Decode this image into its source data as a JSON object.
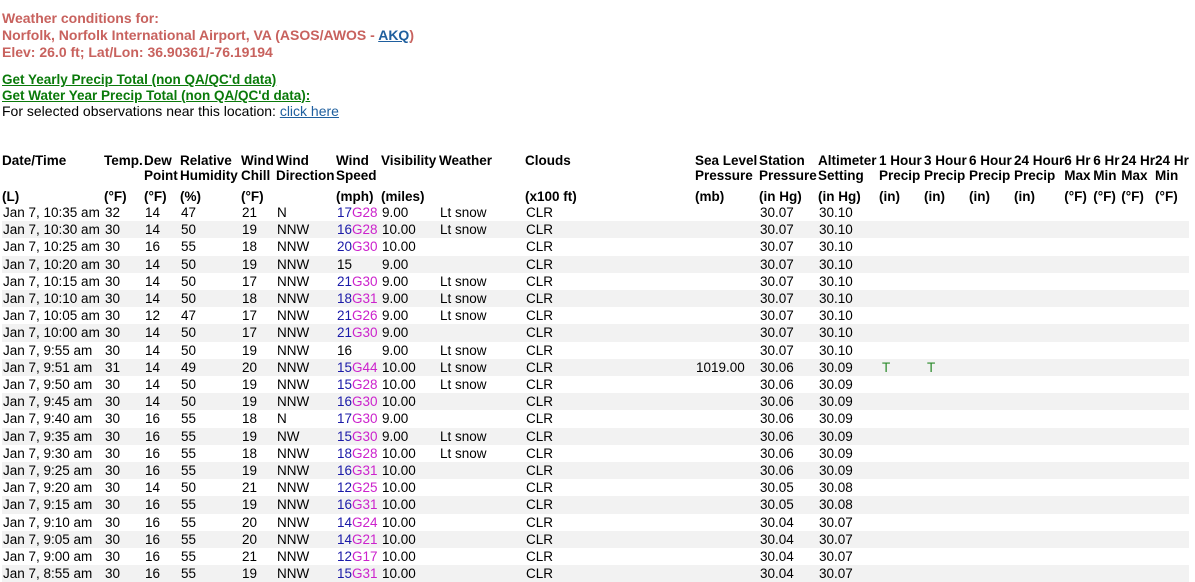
{
  "header": {
    "line1": "Weather conditions for:",
    "line2_prefix": "Norfolk, Norfolk International Airport, VA (ASOS/AWOS - ",
    "line2_link": "AKQ",
    "line2_suffix": ")",
    "line3": "Elev: 26.0 ft; Lat/Lon: 36.90361/-76.19194"
  },
  "links": {
    "yearly": "Get Yearly Precip Total (non QA/QC'd data)",
    "water_year": "Get Water Year Precip Total (non QA/QC'd data):",
    "near_text": "For selected observations near this location: ",
    "near_link": "click here"
  },
  "columns": {
    "date": [
      "Date/Time",
      "",
      "",
      "(L)"
    ],
    "temp": [
      "Temp.",
      "",
      "",
      "(°F)"
    ],
    "dew": [
      "Dew",
      "Point",
      "",
      "(°F)"
    ],
    "rh": [
      "Relative",
      "Humidity",
      "",
      "(%)"
    ],
    "chill": [
      "Wind",
      "Chill",
      "",
      "(°F)"
    ],
    "dir": [
      "Wind",
      "Direction",
      "",
      ""
    ],
    "speed": [
      "Wind",
      "Speed",
      "",
      "(mph)"
    ],
    "vis": [
      "Visibility",
      "",
      "",
      "(miles)"
    ],
    "wx": [
      "Weather",
      "",
      "",
      ""
    ],
    "clouds": [
      "Clouds",
      "",
      "",
      "(x100 ft)"
    ],
    "slp": [
      "Sea Level",
      "Pressure",
      "",
      "(mb)"
    ],
    "stp": [
      "Station",
      "Pressure",
      "",
      "(in Hg)"
    ],
    "alt": [
      "Altimeter",
      "Setting",
      "",
      "(in Hg)"
    ],
    "p1": [
      "1 Hour",
      "Precip",
      "",
      "(in)"
    ],
    "p3": [
      "3 Hour",
      "Precip",
      "",
      "(in)"
    ],
    "p6": [
      "6 Hour",
      "Precip",
      "",
      "(in)"
    ],
    "p24": [
      "24 Hour",
      "Precip",
      "",
      "(in)"
    ],
    "max6": [
      "6 Hr",
      "Max",
      "",
      "(°F)"
    ],
    "min6": [
      "6 Hr",
      "Min",
      "",
      "(°F)"
    ],
    "max24": [
      "24 Hr",
      "Max",
      "",
      "(°F)"
    ],
    "min24": [
      "24 Hr",
      "Min",
      "",
      "(°F)"
    ]
  },
  "rows": [
    {
      "date": "Jan 7, 10:35 am",
      "temp": "32",
      "dew": "14",
      "rh": "47",
      "chill": "21",
      "dir": "N",
      "ws": "17",
      "gust": "G28",
      "vis": "9.00",
      "wx": "Lt snow",
      "clouds": "CLR",
      "slp": "",
      "stp": "30.07",
      "alt": "30.10",
      "p1": "",
      "p3": ""
    },
    {
      "date": "Jan 7, 10:30 am",
      "temp": "30",
      "dew": "14",
      "rh": "50",
      "chill": "19",
      "dir": "NNW",
      "ws": "16",
      "gust": "G28",
      "vis": "10.00",
      "wx": "Lt snow",
      "clouds": "CLR",
      "slp": "",
      "stp": "30.07",
      "alt": "30.10",
      "p1": "",
      "p3": ""
    },
    {
      "date": "Jan 7, 10:25 am",
      "temp": "30",
      "dew": "16",
      "rh": "55",
      "chill": "18",
      "dir": "NNW",
      "ws": "20",
      "gust": "G30",
      "vis": "10.00",
      "wx": "",
      "clouds": "CLR",
      "slp": "",
      "stp": "30.07",
      "alt": "30.10",
      "p1": "",
      "p3": ""
    },
    {
      "date": "Jan 7, 10:20 am",
      "temp": "30",
      "dew": "14",
      "rh": "50",
      "chill": "19",
      "dir": "NNW",
      "ws": "15",
      "gust": "",
      "vis": "9.00",
      "wx": "",
      "clouds": "CLR",
      "slp": "",
      "stp": "30.07",
      "alt": "30.10",
      "p1": "",
      "p3": ""
    },
    {
      "date": "Jan 7, 10:15 am",
      "temp": "30",
      "dew": "14",
      "rh": "50",
      "chill": "17",
      "dir": "NNW",
      "ws": "21",
      "gust": "G30",
      "vis": "9.00",
      "wx": "Lt snow",
      "clouds": "CLR",
      "slp": "",
      "stp": "30.07",
      "alt": "30.10",
      "p1": "",
      "p3": ""
    },
    {
      "date": "Jan 7, 10:10 am",
      "temp": "30",
      "dew": "14",
      "rh": "50",
      "chill": "18",
      "dir": "NNW",
      "ws": "18",
      "gust": "G31",
      "vis": "9.00",
      "wx": "Lt snow",
      "clouds": "CLR",
      "slp": "",
      "stp": "30.07",
      "alt": "30.10",
      "p1": "",
      "p3": ""
    },
    {
      "date": "Jan 7, 10:05 am",
      "temp": "30",
      "dew": "12",
      "rh": "47",
      "chill": "17",
      "dir": "NNW",
      "ws": "21",
      "gust": "G26",
      "vis": "9.00",
      "wx": "Lt snow",
      "clouds": "CLR",
      "slp": "",
      "stp": "30.07",
      "alt": "30.10",
      "p1": "",
      "p3": ""
    },
    {
      "date": "Jan 7, 10:00 am",
      "temp": "30",
      "dew": "14",
      "rh": "50",
      "chill": "17",
      "dir": "NNW",
      "ws": "21",
      "gust": "G30",
      "vis": "9.00",
      "wx": "",
      "clouds": "CLR",
      "slp": "",
      "stp": "30.07",
      "alt": "30.10",
      "p1": "",
      "p3": ""
    },
    {
      "date": "Jan 7, 9:55 am",
      "temp": "30",
      "dew": "14",
      "rh": "50",
      "chill": "19",
      "dir": "NNW",
      "ws": "16",
      "gust": "",
      "vis": "9.00",
      "wx": "Lt snow",
      "clouds": "CLR",
      "slp": "",
      "stp": "30.07",
      "alt": "30.10",
      "p1": "",
      "p3": ""
    },
    {
      "date": "Jan 7, 9:51 am",
      "temp": "31",
      "dew": "14",
      "rh": "49",
      "chill": "20",
      "dir": "NNW",
      "ws": "15",
      "gust": "G44",
      "vis": "10.00",
      "wx": "Lt snow",
      "clouds": "CLR",
      "slp": "1019.00",
      "stp": "30.06",
      "alt": "30.09",
      "p1": "T",
      "p3": "T"
    },
    {
      "date": "Jan 7, 9:50 am",
      "temp": "30",
      "dew": "14",
      "rh": "50",
      "chill": "19",
      "dir": "NNW",
      "ws": "15",
      "gust": "G28",
      "vis": "10.00",
      "wx": "Lt snow",
      "clouds": "CLR",
      "slp": "",
      "stp": "30.06",
      "alt": "30.09",
      "p1": "",
      "p3": ""
    },
    {
      "date": "Jan 7, 9:45 am",
      "temp": "30",
      "dew": "14",
      "rh": "50",
      "chill": "19",
      "dir": "NNW",
      "ws": "16",
      "gust": "G30",
      "vis": "10.00",
      "wx": "",
      "clouds": "CLR",
      "slp": "",
      "stp": "30.06",
      "alt": "30.09",
      "p1": "",
      "p3": ""
    },
    {
      "date": "Jan 7, 9:40 am",
      "temp": "30",
      "dew": "16",
      "rh": "55",
      "chill": "18",
      "dir": "N",
      "ws": "17",
      "gust": "G30",
      "vis": "9.00",
      "wx": "",
      "clouds": "CLR",
      "slp": "",
      "stp": "30.06",
      "alt": "30.09",
      "p1": "",
      "p3": ""
    },
    {
      "date": "Jan 7, 9:35 am",
      "temp": "30",
      "dew": "16",
      "rh": "55",
      "chill": "19",
      "dir": "NW",
      "ws": "15",
      "gust": "G30",
      "vis": "9.00",
      "wx": "Lt snow",
      "clouds": "CLR",
      "slp": "",
      "stp": "30.06",
      "alt": "30.09",
      "p1": "",
      "p3": ""
    },
    {
      "date": "Jan 7, 9:30 am",
      "temp": "30",
      "dew": "16",
      "rh": "55",
      "chill": "18",
      "dir": "NNW",
      "ws": "18",
      "gust": "G28",
      "vis": "10.00",
      "wx": "Lt snow",
      "clouds": "CLR",
      "slp": "",
      "stp": "30.06",
      "alt": "30.09",
      "p1": "",
      "p3": ""
    },
    {
      "date": "Jan 7, 9:25 am",
      "temp": "30",
      "dew": "16",
      "rh": "55",
      "chill": "19",
      "dir": "NNW",
      "ws": "16",
      "gust": "G31",
      "vis": "10.00",
      "wx": "",
      "clouds": "CLR",
      "slp": "",
      "stp": "30.06",
      "alt": "30.09",
      "p1": "",
      "p3": ""
    },
    {
      "date": "Jan 7, 9:20 am",
      "temp": "30",
      "dew": "14",
      "rh": "50",
      "chill": "21",
      "dir": "NNW",
      "ws": "12",
      "gust": "G25",
      "vis": "10.00",
      "wx": "",
      "clouds": "CLR",
      "slp": "",
      "stp": "30.05",
      "alt": "30.08",
      "p1": "",
      "p3": ""
    },
    {
      "date": "Jan 7, 9:15 am",
      "temp": "30",
      "dew": "16",
      "rh": "55",
      "chill": "19",
      "dir": "NNW",
      "ws": "16",
      "gust": "G31",
      "vis": "10.00",
      "wx": "",
      "clouds": "CLR",
      "slp": "",
      "stp": "30.05",
      "alt": "30.08",
      "p1": "",
      "p3": ""
    },
    {
      "date": "Jan 7, 9:10 am",
      "temp": "30",
      "dew": "16",
      "rh": "55",
      "chill": "20",
      "dir": "NNW",
      "ws": "14",
      "gust": "G24",
      "vis": "10.00",
      "wx": "",
      "clouds": "CLR",
      "slp": "",
      "stp": "30.04",
      "alt": "30.07",
      "p1": "",
      "p3": ""
    },
    {
      "date": "Jan 7, 9:05 am",
      "temp": "30",
      "dew": "16",
      "rh": "55",
      "chill": "20",
      "dir": "NNW",
      "ws": "14",
      "gust": "G21",
      "vis": "10.00",
      "wx": "",
      "clouds": "CLR",
      "slp": "",
      "stp": "30.04",
      "alt": "30.07",
      "p1": "",
      "p3": ""
    },
    {
      "date": "Jan 7, 9:00 am",
      "temp": "30",
      "dew": "16",
      "rh": "55",
      "chill": "21",
      "dir": "NNW",
      "ws": "12",
      "gust": "G17",
      "vis": "10.00",
      "wx": "",
      "clouds": "CLR",
      "slp": "",
      "stp": "30.04",
      "alt": "30.07",
      "p1": "",
      "p3": ""
    },
    {
      "date": "Jan 7, 8:55 am",
      "temp": "30",
      "dew": "16",
      "rh": "55",
      "chill": "19",
      "dir": "NNW",
      "ws": "15",
      "gust": "G31",
      "vis": "10.00",
      "wx": "",
      "clouds": "CLR",
      "slp": "",
      "stp": "30.04",
      "alt": "30.07",
      "p1": "",
      "p3": ""
    }
  ],
  "colors": {
    "header": "#c8625e",
    "link": "#1f5f9e",
    "green_link": "#0a7a0a",
    "wind_speed": "#1a1aa8",
    "gust": "#cc22cc",
    "trace": "#2a8a2a",
    "alt_row": "#f2f2f2"
  }
}
